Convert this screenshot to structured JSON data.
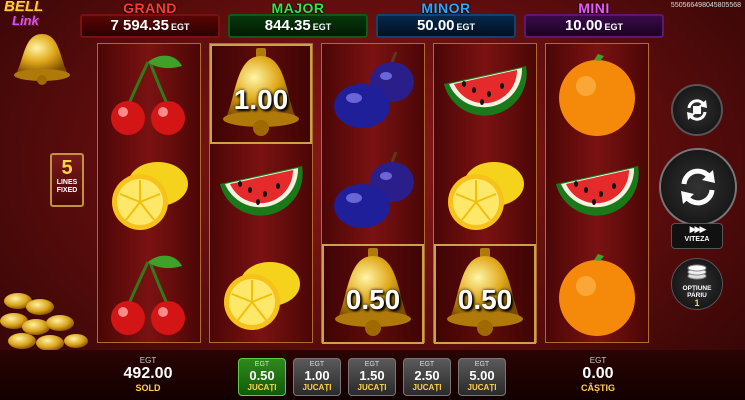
{
  "game_id": "550566498045805568",
  "logo": {
    "line1": "BELL",
    "line2": "Link"
  },
  "jackpots": [
    {
      "name": "GRAND",
      "value": "7 594.35",
      "currency": "EGT"
    },
    {
      "name": "MAJOR",
      "value": "844.35",
      "currency": "EGT"
    },
    {
      "name": "MINOR",
      "value": "50.00",
      "currency": "EGT"
    },
    {
      "name": "MINI",
      "value": "10.00",
      "currency": "EGT"
    }
  ],
  "lines": {
    "count": "5",
    "label1": "LINES",
    "label2": "FIXED"
  },
  "reels": [
    [
      {
        "symbol": "cherry"
      },
      {
        "symbol": "lemon"
      },
      {
        "symbol": "cherry"
      }
    ],
    [
      {
        "symbol": "bell",
        "value": "1.00"
      },
      {
        "symbol": "watermelon"
      },
      {
        "symbol": "lemon"
      }
    ],
    [
      {
        "symbol": "plum"
      },
      {
        "symbol": "plum"
      },
      {
        "symbol": "bell",
        "value": "0.50"
      }
    ],
    [
      {
        "symbol": "watermelon"
      },
      {
        "symbol": "lemon"
      },
      {
        "symbol": "bell",
        "value": "0.50"
      }
    ],
    [
      {
        "symbol": "orange"
      },
      {
        "symbol": "watermelon"
      },
      {
        "symbol": "orange"
      }
    ]
  ],
  "controls": {
    "autoplay_icon": "autoplay-icon",
    "spin_icon": "spin-icon",
    "speed_label": "VITEZA",
    "bet_options_label1": "OPȚIUNE",
    "bet_options_label2": "PARIU",
    "bet_options_value": "1"
  },
  "balance": {
    "currency": "EGT",
    "value": "492.00",
    "label": "SOLD"
  },
  "bets": [
    {
      "currency": "EGT",
      "value": "0.50",
      "label": "JUCAȚI",
      "active": true
    },
    {
      "currency": "EGT",
      "value": "1.00",
      "label": "JUCAȚI",
      "active": false
    },
    {
      "currency": "EGT",
      "value": "1.50",
      "label": "JUCAȚI",
      "active": false
    },
    {
      "currency": "EGT",
      "value": "2.50",
      "label": "JUCAȚI",
      "active": false
    },
    {
      "currency": "EGT",
      "value": "5.00",
      "label": "JUCAȚI",
      "active": false
    }
  ],
  "win": {
    "currency": "EGT",
    "value": "0.00",
    "label": "CÂȘTIG"
  },
  "colors": {
    "accent_gold": "#ffd34a",
    "active_bet": "#2f8a1e"
  }
}
